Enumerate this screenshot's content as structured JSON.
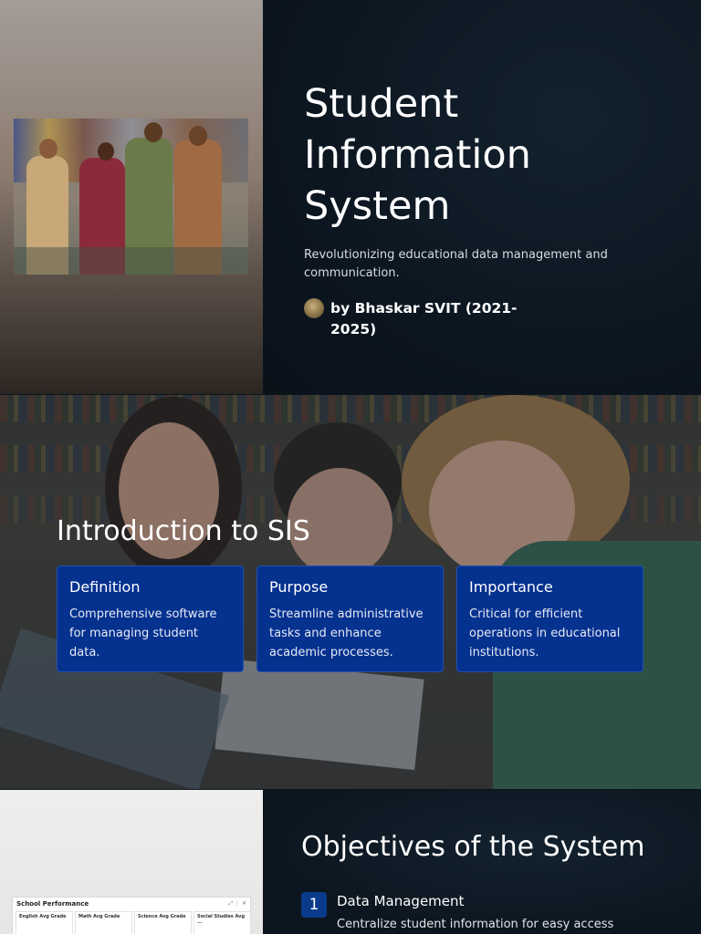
{
  "slide1": {
    "title": "Student Information System",
    "subtitle": "Revolutionizing educational data management and communication.",
    "author": "by Bhaskar  SVIT (2021-2025)"
  },
  "slide2": {
    "title": "Introduction to SIS",
    "cards": [
      {
        "heading": "Definition",
        "text": "Comprehensive software for managing student data."
      },
      {
        "heading": "Purpose",
        "text": "Streamline administrative tasks and enhance academic processes."
      },
      {
        "heading": "Importance",
        "text": "Critical for efficient operations in educational institutions."
      }
    ]
  },
  "slide3": {
    "title": "Objectives of the System",
    "panel": {
      "title": "School Performance",
      "controls": "⤢ ⋮ ✕",
      "columns": [
        "English Avg Grade",
        "Math Avg Grade",
        "Science Avg Grade",
        "Social Studies Avg ..."
      ]
    },
    "objectives": [
      {
        "number": "1",
        "heading": "Data Management",
        "text": "Centralize student information for easy access and"
      }
    ]
  },
  "colors": {
    "dark_bg": "#0b1620",
    "card_blue": "#05318f",
    "badge_blue": "#0a3a8a"
  }
}
